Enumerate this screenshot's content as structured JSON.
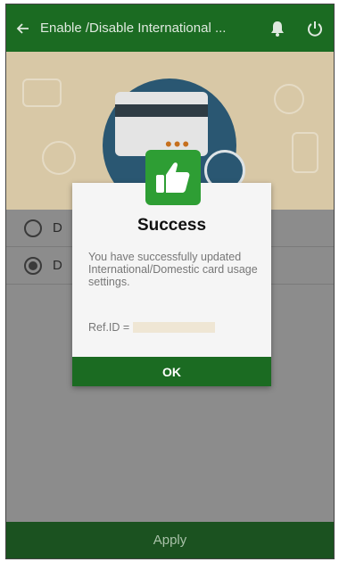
{
  "header": {
    "title": "Enable /Disable International ...",
    "back_icon": "back-arrow-icon",
    "bell_icon": "bell-icon",
    "power_icon": "power-icon"
  },
  "options": [
    {
      "label": "D",
      "selected": false
    },
    {
      "label": "D",
      "selected": true
    }
  ],
  "modal": {
    "title": "Success",
    "message": "You have successfully updated International/Domestic card usage settings.",
    "ref_label": "Ref.ID =",
    "ok_label": "OK",
    "icon": "thumbs-up-icon"
  },
  "footer": {
    "apply_label": "Apply"
  },
  "colors": {
    "primary_green": "#1b6b22",
    "apply_bar": "#1b5220",
    "success_icon": "#2e9e34"
  }
}
